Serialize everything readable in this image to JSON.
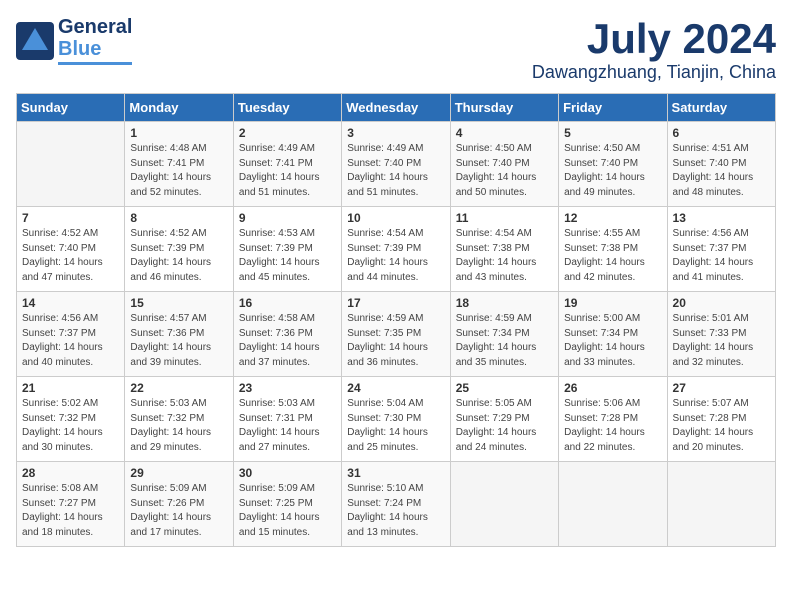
{
  "logo": {
    "line1": "General",
    "line2": "Blue"
  },
  "title": "July 2024",
  "location": "Dawangzhuang, Tianjin, China",
  "days_of_week": [
    "Sunday",
    "Monday",
    "Tuesday",
    "Wednesday",
    "Thursday",
    "Friday",
    "Saturday"
  ],
  "weeks": [
    [
      {
        "day": "",
        "content": ""
      },
      {
        "day": "1",
        "content": "Sunrise: 4:48 AM\nSunset: 7:41 PM\nDaylight: 14 hours\nand 52 minutes."
      },
      {
        "day": "2",
        "content": "Sunrise: 4:49 AM\nSunset: 7:41 PM\nDaylight: 14 hours\nand 51 minutes."
      },
      {
        "day": "3",
        "content": "Sunrise: 4:49 AM\nSunset: 7:40 PM\nDaylight: 14 hours\nand 51 minutes."
      },
      {
        "day": "4",
        "content": "Sunrise: 4:50 AM\nSunset: 7:40 PM\nDaylight: 14 hours\nand 50 minutes."
      },
      {
        "day": "5",
        "content": "Sunrise: 4:50 AM\nSunset: 7:40 PM\nDaylight: 14 hours\nand 49 minutes."
      },
      {
        "day": "6",
        "content": "Sunrise: 4:51 AM\nSunset: 7:40 PM\nDaylight: 14 hours\nand 48 minutes."
      }
    ],
    [
      {
        "day": "7",
        "content": "Sunrise: 4:52 AM\nSunset: 7:40 PM\nDaylight: 14 hours\nand 47 minutes."
      },
      {
        "day": "8",
        "content": "Sunrise: 4:52 AM\nSunset: 7:39 PM\nDaylight: 14 hours\nand 46 minutes."
      },
      {
        "day": "9",
        "content": "Sunrise: 4:53 AM\nSunset: 7:39 PM\nDaylight: 14 hours\nand 45 minutes."
      },
      {
        "day": "10",
        "content": "Sunrise: 4:54 AM\nSunset: 7:39 PM\nDaylight: 14 hours\nand 44 minutes."
      },
      {
        "day": "11",
        "content": "Sunrise: 4:54 AM\nSunset: 7:38 PM\nDaylight: 14 hours\nand 43 minutes."
      },
      {
        "day": "12",
        "content": "Sunrise: 4:55 AM\nSunset: 7:38 PM\nDaylight: 14 hours\nand 42 minutes."
      },
      {
        "day": "13",
        "content": "Sunrise: 4:56 AM\nSunset: 7:37 PM\nDaylight: 14 hours\nand 41 minutes."
      }
    ],
    [
      {
        "day": "14",
        "content": "Sunrise: 4:56 AM\nSunset: 7:37 PM\nDaylight: 14 hours\nand 40 minutes."
      },
      {
        "day": "15",
        "content": "Sunrise: 4:57 AM\nSunset: 7:36 PM\nDaylight: 14 hours\nand 39 minutes."
      },
      {
        "day": "16",
        "content": "Sunrise: 4:58 AM\nSunset: 7:36 PM\nDaylight: 14 hours\nand 37 minutes."
      },
      {
        "day": "17",
        "content": "Sunrise: 4:59 AM\nSunset: 7:35 PM\nDaylight: 14 hours\nand 36 minutes."
      },
      {
        "day": "18",
        "content": "Sunrise: 4:59 AM\nSunset: 7:34 PM\nDaylight: 14 hours\nand 35 minutes."
      },
      {
        "day": "19",
        "content": "Sunrise: 5:00 AM\nSunset: 7:34 PM\nDaylight: 14 hours\nand 33 minutes."
      },
      {
        "day": "20",
        "content": "Sunrise: 5:01 AM\nSunset: 7:33 PM\nDaylight: 14 hours\nand 32 minutes."
      }
    ],
    [
      {
        "day": "21",
        "content": "Sunrise: 5:02 AM\nSunset: 7:32 PM\nDaylight: 14 hours\nand 30 minutes."
      },
      {
        "day": "22",
        "content": "Sunrise: 5:03 AM\nSunset: 7:32 PM\nDaylight: 14 hours\nand 29 minutes."
      },
      {
        "day": "23",
        "content": "Sunrise: 5:03 AM\nSunset: 7:31 PM\nDaylight: 14 hours\nand 27 minutes."
      },
      {
        "day": "24",
        "content": "Sunrise: 5:04 AM\nSunset: 7:30 PM\nDaylight: 14 hours\nand 25 minutes."
      },
      {
        "day": "25",
        "content": "Sunrise: 5:05 AM\nSunset: 7:29 PM\nDaylight: 14 hours\nand 24 minutes."
      },
      {
        "day": "26",
        "content": "Sunrise: 5:06 AM\nSunset: 7:28 PM\nDaylight: 14 hours\nand 22 minutes."
      },
      {
        "day": "27",
        "content": "Sunrise: 5:07 AM\nSunset: 7:28 PM\nDaylight: 14 hours\nand 20 minutes."
      }
    ],
    [
      {
        "day": "28",
        "content": "Sunrise: 5:08 AM\nSunset: 7:27 PM\nDaylight: 14 hours\nand 18 minutes."
      },
      {
        "day": "29",
        "content": "Sunrise: 5:09 AM\nSunset: 7:26 PM\nDaylight: 14 hours\nand 17 minutes."
      },
      {
        "day": "30",
        "content": "Sunrise: 5:09 AM\nSunset: 7:25 PM\nDaylight: 14 hours\nand 15 minutes."
      },
      {
        "day": "31",
        "content": "Sunrise: 5:10 AM\nSunset: 7:24 PM\nDaylight: 14 hours\nand 13 minutes."
      },
      {
        "day": "",
        "content": ""
      },
      {
        "day": "",
        "content": ""
      },
      {
        "day": "",
        "content": ""
      }
    ]
  ]
}
